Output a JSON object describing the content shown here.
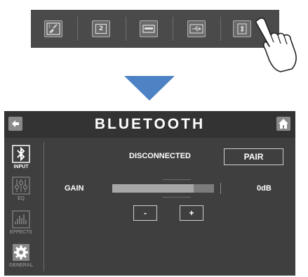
{
  "selector_strip": {
    "buttons": [
      {
        "icon": "guitar-input-icon"
      },
      {
        "icon": "input-2-icon",
        "label": "2"
      },
      {
        "icon": "keyboard-icon"
      },
      {
        "icon": "usb-icon"
      },
      {
        "icon": "bluetooth-icon"
      }
    ],
    "pointer": "hand-pointer-icon"
  },
  "screen": {
    "title": "BLUETOOTH",
    "back_icon": "back-arrow-icon",
    "home_icon": "home-icon",
    "sidebar": [
      {
        "icon": "bluetooth-icon",
        "label": "INPUT",
        "active": true
      },
      {
        "icon": "eq-sliders-icon",
        "label": "EQ",
        "active": false
      },
      {
        "icon": "effects-bars-icon",
        "label": "EFFECTS",
        "active": false
      },
      {
        "icon": "gear-icon",
        "label": "GENERAL",
        "active": false
      }
    ],
    "status": "DISCONNECTED",
    "pair_button": "PAIR",
    "gain": {
      "label": "GAIN",
      "value_text": "0dB",
      "level_fraction": 0.8
    },
    "minus_button": "-",
    "plus_button": "+"
  },
  "colors": {
    "arrow": "#4d82c4",
    "screen_bg": "#3f3f3f",
    "strip_bg": "#4a4a4a"
  }
}
